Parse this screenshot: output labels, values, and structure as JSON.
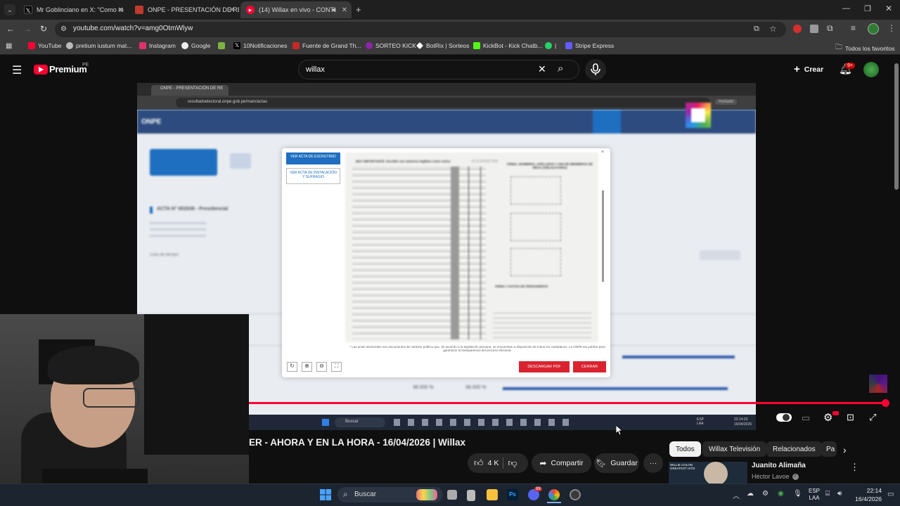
{
  "browser": {
    "tabs": [
      {
        "label": "Mr Goblinciano en X: \"Como m",
        "icon": "x-icon",
        "active": false
      },
      {
        "label": "ONPE - PRESENTACIÓN DE RES",
        "icon": "onpe-icon",
        "active": false
      },
      {
        "label": "(14) Willax en vivo - CONTI",
        "icon": "youtube-icon",
        "active": true
      }
    ],
    "url": "youtube.com/watch?v=amg0OtmWlyw",
    "bookmarks": [
      "YouTube",
      "pretium iustum mat...",
      "Instagram",
      "Google",
      "",
      "10Notificaciones",
      "Fuente de Grand Th...",
      "SORTEO KICK",
      "BotRix | Sorteos",
      "KickBot - Kick Chatb...",
      "|",
      "Stripe Express"
    ],
    "all_favorites": "Todos los favoritos"
  },
  "youtube": {
    "logo": "Premium",
    "region": "PE",
    "search_value": "willax",
    "create_label": "Crear",
    "notif_count": "9+"
  },
  "video_content": {
    "inner_tab": "ONPE - PRESENTACIÓN DE RE",
    "inner_url": "resultadoelectoral.onpe.gob.pe/main/actas",
    "invitado": "Invitado",
    "onpe_logo": "ONPE",
    "acta_title": "ACTA N° 002938 - Presidencial",
    "lista": "Lista de tiempo",
    "modal_tab_active": "VER ACTA DE ESCRUTINIO",
    "modal_tab_2": "VER ACTA DE INSTALACIÓN Y SUFRAGIO",
    "acta_header": "MUY IMPORTANTE: Escribir con números legibles como estos:",
    "acta_numbers": "0123456789",
    "firma_header": "FIRMA, NOMBRES, APELLIDOS Y DNI DE MIEMBROS DE MESA (OBLIGATORIO)",
    "personeros_header": "FIRMA Y DATOS DE PERSONEROS",
    "footer_note": "* Las actas electorales son documentos de carácter público que, de acuerdo a la legislación peruana, se encuentran a disposición de todos los ciudadanos. La ONPE las publica para garantizar la transparencia del proceso electoral.",
    "btn_pdf": "DESCARGAR PDF",
    "btn_close": "CERRAR",
    "pct1": "38.000 %",
    "pct2": "38.000 %",
    "inner_search": "Buscar",
    "inner_lang": "ESP\nLAA",
    "inner_time": "22:14:23",
    "inner_date": "16/04/2026"
  },
  "video_info": {
    "title": "ER - AHORA Y EN LA HORA - 16/04/2026 | Willax",
    "likes": "4 K",
    "share": "Compartir",
    "save": "Guardar"
  },
  "sidebar": {
    "chips": [
      "Todos",
      "Willax Televisión",
      "Relacionados",
      "Pa"
    ],
    "rec_title": "Juanito Alimaña",
    "rec_channel": "Héctor Lavoe",
    "rec_thumb_text": "WILLIE COLON\nGREATEST HITS"
  },
  "taskbar": {
    "search": "Buscar",
    "lang": "ESP\nLAA",
    "time": "22:14",
    "date": "16/4/2026"
  },
  "colors": {
    "yt_red": "#ff0033",
    "onpe_blue": "#1e6fc0",
    "cerrar_red": "#d9232e"
  }
}
